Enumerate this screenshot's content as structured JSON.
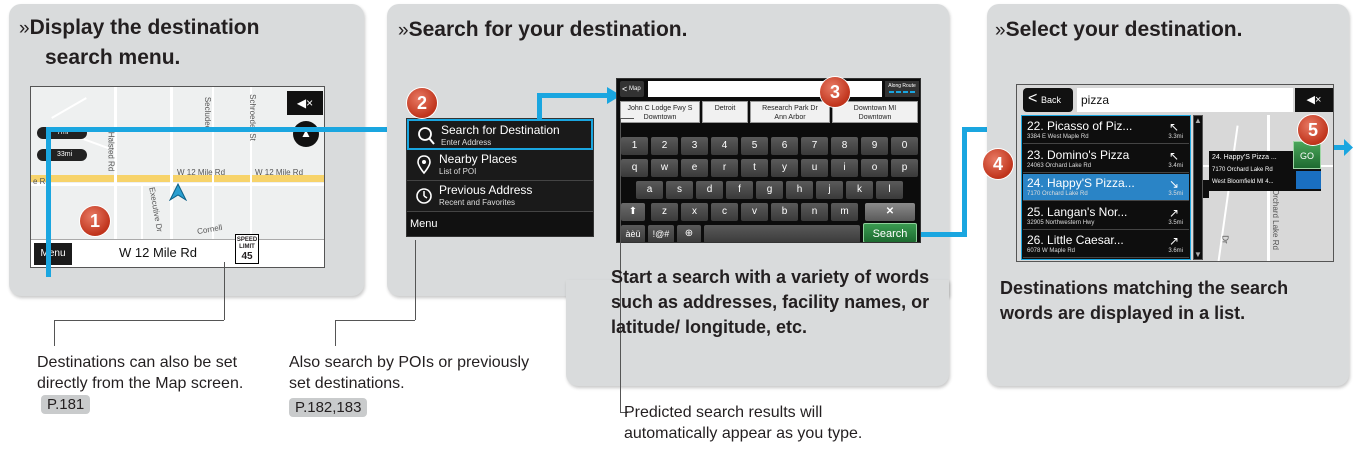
{
  "steps": [
    {
      "mark": "»",
      "title_line1": "Display the destination",
      "title_line2": "search menu."
    },
    {
      "mark": "»",
      "title_line1": "Search for your destination."
    },
    {
      "mark": "»",
      "title_line1": "Select your destination."
    }
  ],
  "badges": [
    "1",
    "2",
    "3",
    "4",
    "5"
  ],
  "map_screen": {
    "street_halsted": "Halsted Rd",
    "street_secluded": "Secluded",
    "street_schroeder": "Schroeder St",
    "street_w12": "W 12 Mile Rd",
    "street_w12_b": "W 12 Mile Rd",
    "street_executive": "Executive Dr",
    "street_left": "e Rd",
    "street_cornell": "Cornell",
    "dist1": "7mi",
    "dist2": "33mi",
    "menu_label": "Menu",
    "road_name": "W 12 Mile Rd",
    "speed_label": "SPEED LIMIT",
    "speed_value": "45",
    "mute_icon": "speaker-mute-icon",
    "compass_icon": "compass-icon"
  },
  "menu_screen": {
    "items": [
      {
        "title": "Search for Destination",
        "sub": "Enter Address",
        "icon": "search-icon"
      },
      {
        "title": "Nearby Places",
        "sub": "List of POI",
        "icon": "pin-icon"
      },
      {
        "title": "Previous Address",
        "sub": "Recent and Favorites",
        "icon": "clock-icon"
      }
    ],
    "menu_label": "Menu"
  },
  "keyboard_screen": {
    "back_label": "Map",
    "along_route": "Along Route",
    "suggestions": [
      {
        "line1": "John C Lodge Fwy S",
        "line2": "Downtown"
      },
      {
        "line1": "Detroit",
        "line2": ""
      },
      {
        "line1": "Research Park Dr",
        "line2": "Ann Arbor"
      },
      {
        "line1": "Downtown MI",
        "line2": "Downtown"
      }
    ],
    "row_numbers": [
      "1",
      "2",
      "3",
      "4",
      "5",
      "6",
      "7",
      "8",
      "9",
      "0"
    ],
    "row_q": [
      "q",
      "w",
      "e",
      "r",
      "t",
      "y",
      "u",
      "i",
      "o",
      "p"
    ],
    "row_a": [
      "a",
      "s",
      "d",
      "f",
      "g",
      "h",
      "j",
      "k",
      "l"
    ],
    "row_z": [
      "z",
      "x",
      "c",
      "v",
      "b",
      "n",
      "m"
    ],
    "key_accents": "àèü",
    "key_symbols": "!@#",
    "search_label": "Search"
  },
  "list_screen": {
    "back_label": "Back",
    "query": "pizza",
    "results": [
      {
        "title": "22. Picasso of Piz...",
        "address": "3384 E West Maple Rd",
        "dist": "3.3mi"
      },
      {
        "title": "23. Domino's Pizza",
        "address": "24063 Orchard Lake Rd",
        "dist": "3.4mi"
      },
      {
        "title": "24. Happy'S Pizza...",
        "address": "7170 Orchard Lake Rd",
        "dist": "3.5mi"
      },
      {
        "title": "25. Langan's Nor...",
        "address": "32905 Northwestern Hwy",
        "dist": "3.5mi"
      },
      {
        "title": "26. Little Caesar...",
        "address": "6078 W Maple Rd",
        "dist": "3.6mi"
      }
    ],
    "popup_title": "24. Happy'S Pizza ...",
    "popup_addr1": "7170 Orchard Lake Rd",
    "popup_addr2": "West Bloomfield MI 4...",
    "go_label": "GO",
    "street_orchard": "Orchard Lake Rd",
    "street_dr": "Dr"
  },
  "captions": {
    "c1_text": "Destinations can also be set directly from the Map screen.",
    "c1_ref": "P.181",
    "c2_text": "Also search by POIs or previously set destinations.",
    "c2_ref": "P.182,183",
    "c3_text": "Start a search with a variety of words such as addresses, facility names, or latitude/ longitude, etc.",
    "c4_text": "Predicted search results will automatically appear as you type.",
    "c5_text": "Destinations matching the search words are displayed in a list."
  }
}
